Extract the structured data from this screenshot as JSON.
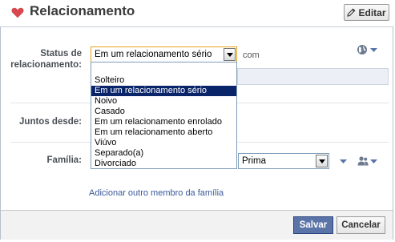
{
  "header": {
    "title": "Relacionamento",
    "edit_label": "Editar"
  },
  "relationship": {
    "status_label": "Status de relacionamento:",
    "selected_value": "Em um relacionamento sério",
    "with_text": "com",
    "options": [
      "Solteiro",
      "Em um relacionamento sério",
      "Noivo",
      "Casado",
      "Em um relacionamento enrolado",
      "Em um relacionamento aberto",
      "Viúvo",
      "Separado(a)",
      "Divorciado"
    ],
    "highlighted_index": 1
  },
  "together": {
    "label": "Juntos desde:"
  },
  "family": {
    "label": "Família:",
    "relation_value": "Prima",
    "add_link": "Adicionar outro membro da família"
  },
  "footer": {
    "save_label": "Salvar",
    "cancel_label": "Cancelar"
  },
  "colors": {
    "heart": "#d8484f",
    "link": "#3b5998",
    "save_bg": "#5b74a8",
    "selected_option_bg": "#0a246a",
    "focus_border": "#e6a21a"
  },
  "icons": {
    "section": "heart-icon",
    "edit": "pencil-icon",
    "privacy": "globe-icon",
    "family_privacy": "people-icon"
  }
}
